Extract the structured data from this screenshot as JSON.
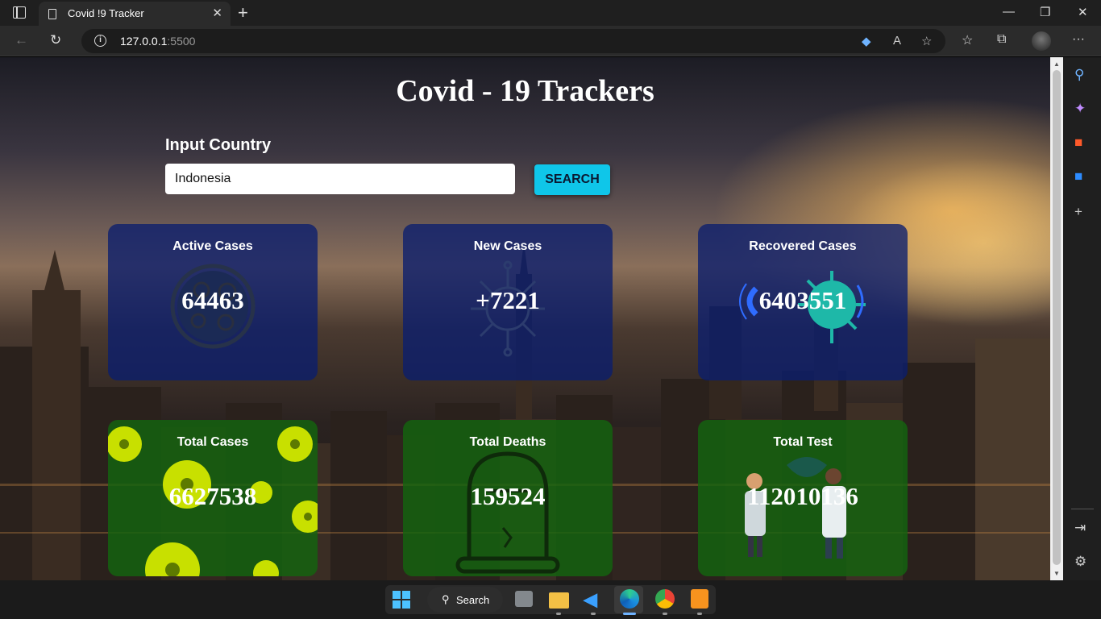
{
  "browser": {
    "tab_title": "Covid !9 Tracker",
    "url_host": "127.0.0.1",
    "url_port": ":5500"
  },
  "page": {
    "title": "Covid - 19 Trackers",
    "input_label": "Input Country",
    "input_value": "Indonesia",
    "search_label": "SEARCH"
  },
  "cards": [
    {
      "label": "Active Cases",
      "value": "64463"
    },
    {
      "label": "New Cases",
      "value": "+7221"
    },
    {
      "label": "Recovered Cases",
      "value": "6403551"
    },
    {
      "label": "Total Cases",
      "value": "6627538"
    },
    {
      "label": "Total Deaths",
      "value": "159524"
    },
    {
      "label": "Total Test",
      "value": "112010136"
    }
  ],
  "taskbar": {
    "search_label": "Search"
  },
  "colors": {
    "search_button": "#0fc6e9",
    "card_blue": "#0a1e6e",
    "card_green": "#14640f"
  },
  "icons": [
    "back-icon",
    "refresh-icon",
    "info-icon",
    "favorites-icon",
    "collections-icon",
    "more-icon",
    "search-sidebar-icon",
    "copilot-icon",
    "office-icon",
    "outlook-icon",
    "add-icon",
    "settings-icon"
  ]
}
